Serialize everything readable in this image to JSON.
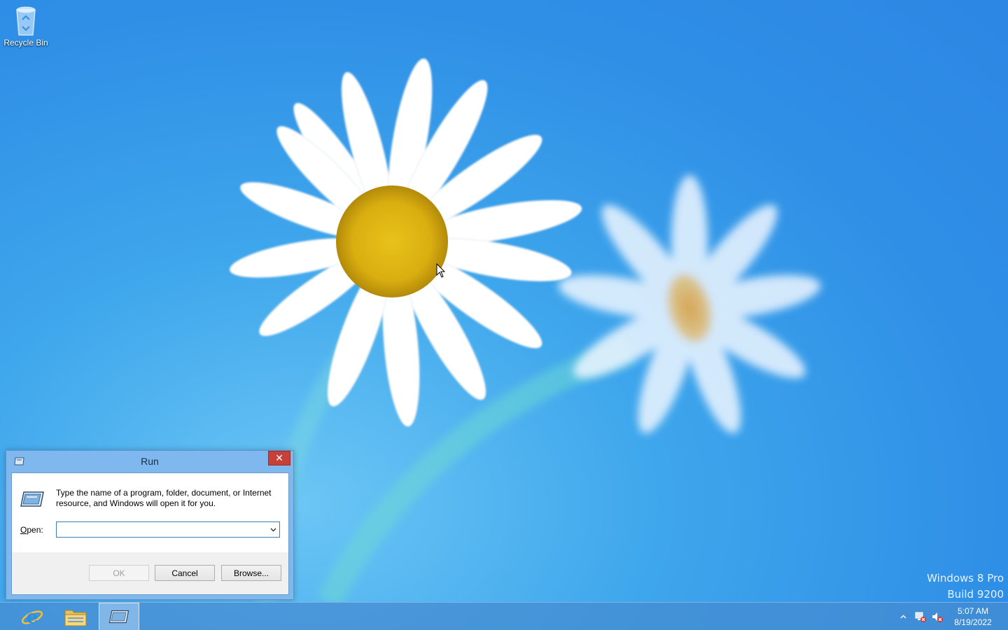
{
  "desktop": {
    "recycle_bin_label": "Recycle Bin",
    "watermark_line1": "Windows 8 Pro",
    "watermark_line2": "Build 9200"
  },
  "run_dialog": {
    "title": "Run",
    "close_label": "✕",
    "description": "Type the name of a program, folder, document, or Internet resource, and Windows will open it for you.",
    "open_label_prefix": "",
    "open_label_accel": "O",
    "open_label_rest": "pen:",
    "open_value": "",
    "ok_label": "OK",
    "cancel_label": "Cancel",
    "browse_label": "Browse...",
    "ok_enabled": false
  },
  "taskbar": {
    "items": [
      {
        "name": "Internet Explorer",
        "icon": "internet-explorer-icon"
      },
      {
        "name": "File Explorer",
        "icon": "file-explorer-icon"
      },
      {
        "name": "Run",
        "icon": "run-icon",
        "active": true
      }
    ],
    "tray": {
      "show_hidden_icon": "chevron-up-icon",
      "network_icon": "network-error-icon",
      "volume_icon": "volume-muted-icon"
    },
    "clock": {
      "time": "5:07 AM",
      "date": "8/19/2022"
    }
  },
  "colors": {
    "close_button": "#c7403a",
    "dialog_frame": "#7eb8ee",
    "desktop_blue": "#2f8fe6"
  }
}
